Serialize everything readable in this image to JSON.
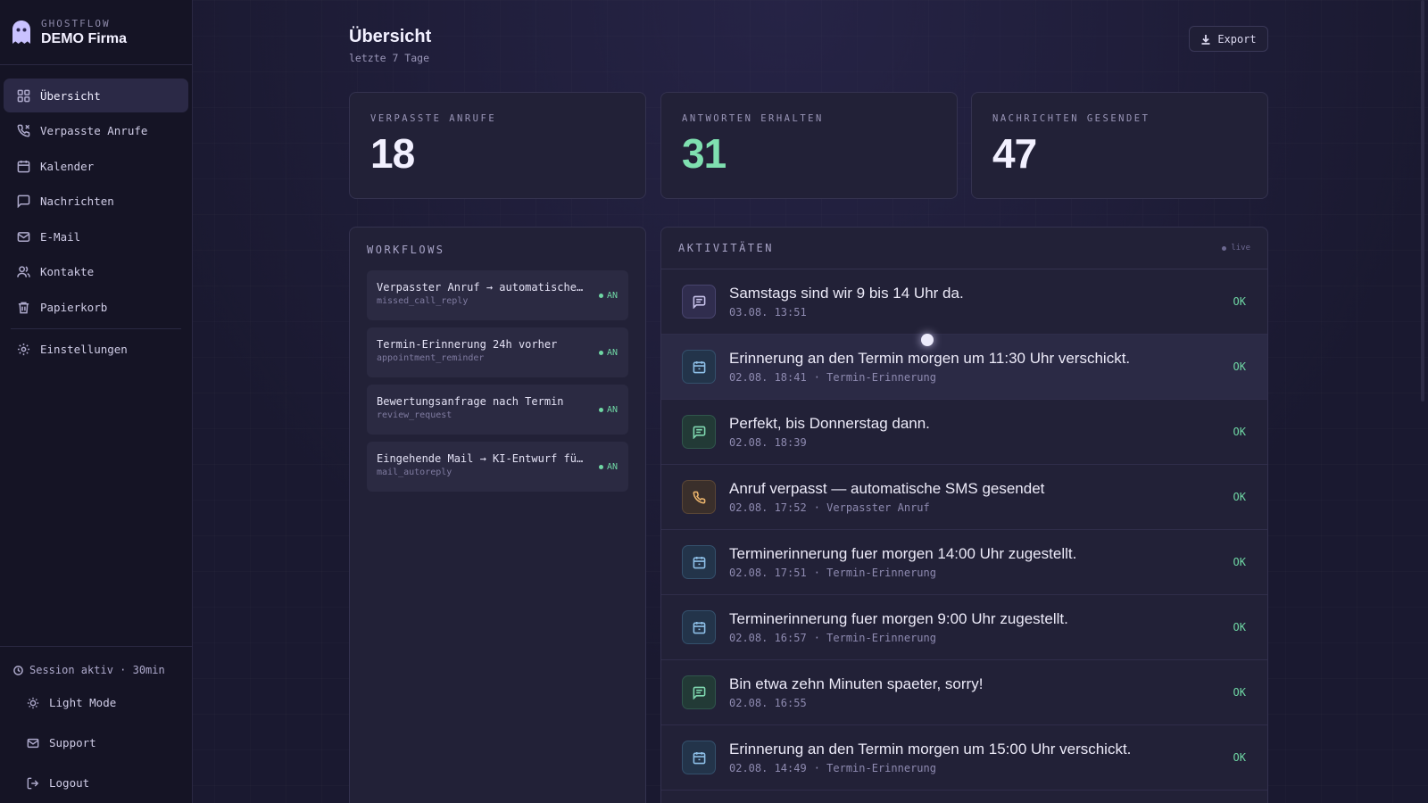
{
  "brand": {
    "sub": "GHOSTFLOW",
    "title": "DEMO Firma"
  },
  "nav": [
    {
      "label": "Übersicht",
      "icon": "grid-icon",
      "active": true
    },
    {
      "label": "Verpasste Anrufe",
      "icon": "phone-missed-icon"
    },
    {
      "label": "Kalender",
      "icon": "calendar-icon"
    },
    {
      "label": "Nachrichten",
      "icon": "message-icon"
    },
    {
      "label": "E-Mail",
      "icon": "mail-icon"
    },
    {
      "label": "Kontakte",
      "icon": "users-icon"
    },
    {
      "label": "Papierkorb",
      "icon": "trash-icon"
    },
    {
      "label": "Einstellungen",
      "icon": "gear-icon"
    }
  ],
  "sidebar_bottom": {
    "session": "Session aktiv · 30min",
    "light_mode": "Light Mode",
    "support": "Support",
    "logout": "Logout"
  },
  "header": {
    "title": "Übersicht",
    "subtitle": "letzte 7 Tage",
    "export": "Export"
  },
  "stats": [
    {
      "label": "VERPASSTE ANRUFE",
      "value": "18"
    },
    {
      "label": "ANTWORTEN ERHALTEN",
      "value": "31"
    },
    {
      "label": "NACHRICHTEN GESENDET",
      "value": "47"
    }
  ],
  "workflows": {
    "title": "WORKFLOWS",
    "items": [
      {
        "name": "Verpasster Anruf → automatische SMS",
        "key": "missed_call_reply",
        "status": "AN"
      },
      {
        "name": "Termin-Erinnerung 24h vorher",
        "key": "appointment_reminder",
        "status": "AN"
      },
      {
        "name": "Bewertungsanfrage nach Termin",
        "key": "review_request",
        "status": "AN"
      },
      {
        "name": "Eingehende Mail → KI-Entwurf für Antwort",
        "key": "mail_autoreply",
        "status": "AN"
      }
    ]
  },
  "activities": {
    "title": "AKTIVITÄTEN",
    "live": "live",
    "items": [
      {
        "type": "msg",
        "icon": "message-icon",
        "title": "Samstags sind wir 9 bis 14 Uhr da.",
        "time": "03.08. 13:51",
        "tag": "",
        "status": "OK"
      },
      {
        "type": "cal",
        "icon": "calendar-icon",
        "title": "Erinnerung an den Termin morgen um 11:30 Uhr verschickt.",
        "time": "02.08. 18:41",
        "tag": "· Termin-Erinnerung",
        "status": "OK"
      },
      {
        "type": "sms",
        "icon": "message-icon",
        "title": "Perfekt, bis Donnerstag dann.",
        "time": "02.08. 18:39",
        "tag": "",
        "status": "OK"
      },
      {
        "type": "phone",
        "icon": "phone-icon",
        "title": "Anruf verpasst — automatische SMS gesendet",
        "time": "02.08. 17:52",
        "tag": "· Verpasster Anruf",
        "status": "OK"
      },
      {
        "type": "cal",
        "icon": "calendar-icon",
        "title": "Terminerinnerung fuer morgen 14:00 Uhr zugestellt.",
        "time": "02.08. 17:51",
        "tag": "· Termin-Erinnerung",
        "status": "OK"
      },
      {
        "type": "cal",
        "icon": "calendar-icon",
        "title": "Terminerinnerung fuer morgen 9:00 Uhr zugestellt.",
        "time": "02.08. 16:57",
        "tag": "· Termin-Erinnerung",
        "status": "OK"
      },
      {
        "type": "sms",
        "icon": "message-icon",
        "title": "Bin etwa zehn Minuten spaeter, sorry!",
        "time": "02.08. 16:55",
        "tag": "",
        "status": "OK"
      },
      {
        "type": "cal",
        "icon": "calendar-icon",
        "title": "Erinnerung an den Termin morgen um 15:00 Uhr verschickt.",
        "time": "02.08. 14:49",
        "tag": "· Termin-Erinnerung",
        "status": "OK"
      }
    ]
  }
}
